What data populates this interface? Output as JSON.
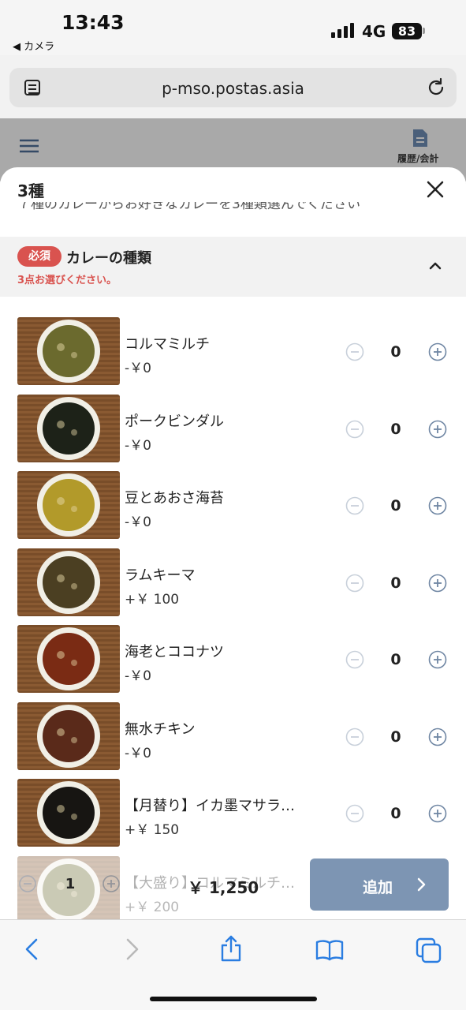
{
  "status_bar": {
    "time": "13:43",
    "back_app": "◀ カメラ",
    "network": "4G",
    "battery": "83"
  },
  "browser": {
    "url": "p-mso.postas.asia"
  },
  "page_header": {
    "history_label": "履歴/会計"
  },
  "sheet": {
    "title": "3種",
    "description": "７種のカレーからお好きなカレーを3種類選んでください",
    "section": {
      "badge": "必須",
      "title": "カレーの種類",
      "subtitle": "3点お選びください。"
    },
    "items": [
      {
        "name": "コルマミルチ",
        "price": "-￥0",
        "qty": "0",
        "color": "#6b6a2e"
      },
      {
        "name": "ポークビンダル",
        "price": "-￥0",
        "qty": "0",
        "color": "#1d2218"
      },
      {
        "name": "豆とあおさ海苔",
        "price": "-￥0",
        "qty": "0",
        "color": "#b29a2a"
      },
      {
        "name": "ラムキーマ",
        "price": "+￥ 100",
        "qty": "0",
        "color": "#4b3f22"
      },
      {
        "name": "海老とココナツ",
        "price": "-￥0",
        "qty": "0",
        "color": "#7a2b14"
      },
      {
        "name": "無水チキン",
        "price": "-￥0",
        "qty": "0",
        "color": "#5a2a1a"
      },
      {
        "name": "【月替り】イカ墨マサラ…",
        "price": "+￥ 150",
        "qty": "0",
        "color": "#171512"
      },
      {
        "name": "【大盛り】コルマミルチ…",
        "price": "+￥ 200",
        "qty": "",
        "color": "#6b6a2e"
      }
    ]
  },
  "footer_bar": {
    "quantity": "1",
    "total": "￥ 1,250",
    "add_label": "追加"
  },
  "colors": {
    "accent": "#7d95b3",
    "required": "#d9534f",
    "link_blue": "#2a7de1"
  }
}
